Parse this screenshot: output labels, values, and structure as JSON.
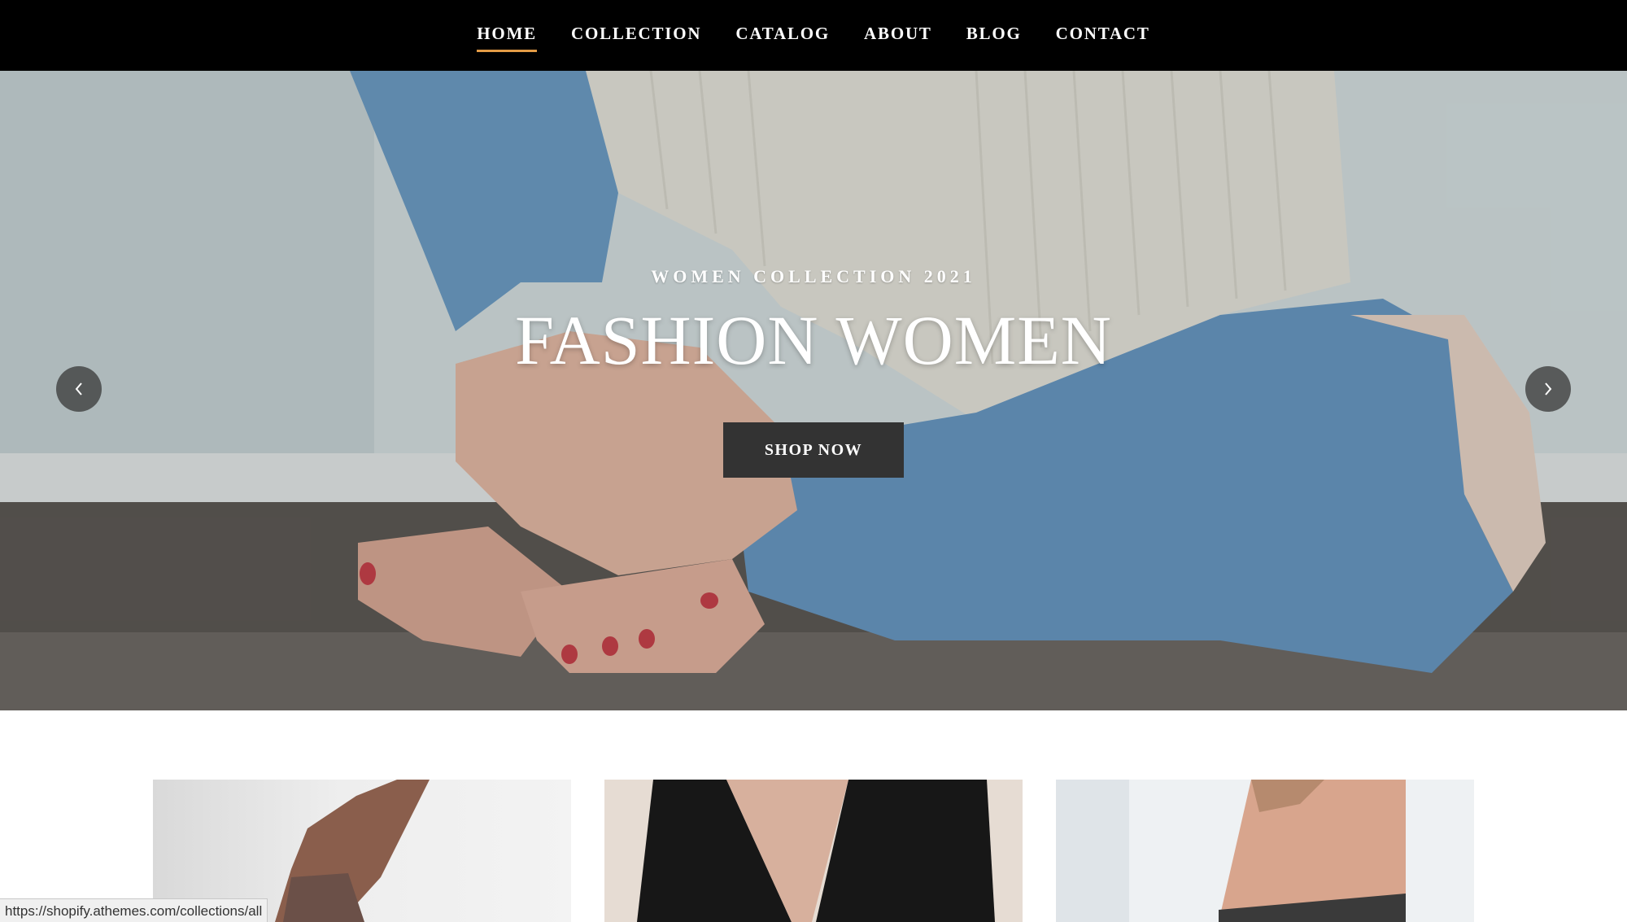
{
  "nav": {
    "items": [
      {
        "label": "HOME",
        "active": true
      },
      {
        "label": "COLLECTION",
        "active": false
      },
      {
        "label": "CATALOG",
        "active": false
      },
      {
        "label": "ABOUT",
        "active": false
      },
      {
        "label": "BLOG",
        "active": false
      },
      {
        "label": "CONTACT",
        "active": false
      }
    ],
    "active_underline_color": "#e39b45"
  },
  "hero": {
    "kicker": "WOMEN COLLECTION 2021",
    "title": "FASHION WOMEN",
    "button_label": "SHOP NOW",
    "prev_icon": "chevron-left-icon",
    "next_icon": "chevron-right-icon"
  },
  "collections": [
    {
      "name": "collection-tile-1"
    },
    {
      "name": "collection-tile-2"
    },
    {
      "name": "collection-tile-3"
    }
  ],
  "status_bar": {
    "url": "https://shopify.athemes.com/collections/all"
  }
}
